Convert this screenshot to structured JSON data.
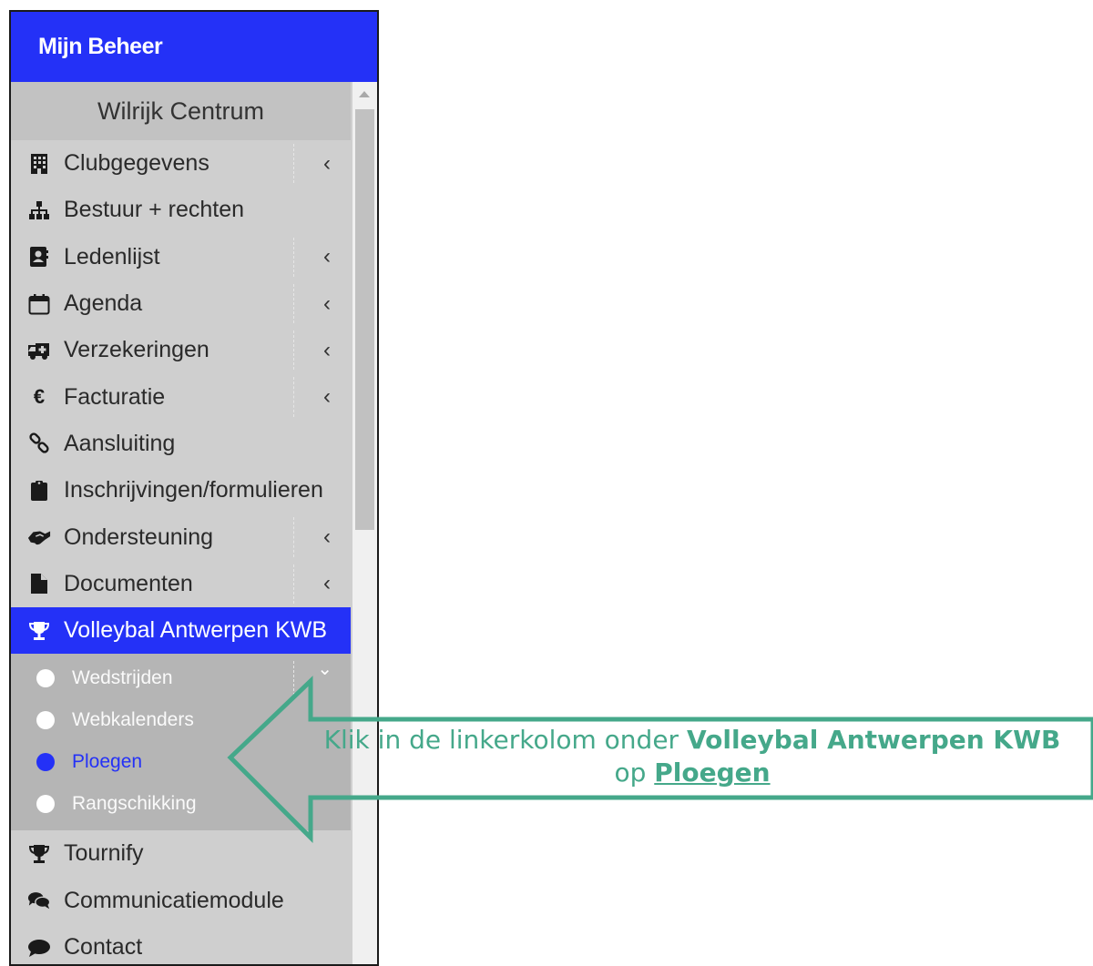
{
  "header": {
    "title": "Mijn Beheer"
  },
  "club_name": "Wilrijk Centrum",
  "menu": [
    {
      "label": "Clubgegevens",
      "icon": "building-icon",
      "expandable": true
    },
    {
      "label": "Bestuur + rechten",
      "icon": "sitemap-icon",
      "expandable": false
    },
    {
      "label": "Ledenlijst",
      "icon": "address-book-icon",
      "expandable": true
    },
    {
      "label": "Agenda",
      "icon": "calendar-icon",
      "expandable": true
    },
    {
      "label": "Verzekeringen",
      "icon": "ambulance-icon",
      "expandable": true
    },
    {
      "label": "Facturatie",
      "icon": "euro-icon",
      "expandable": true
    },
    {
      "label": "Aansluiting",
      "icon": "link-icon",
      "expandable": false
    },
    {
      "label": "Inschrijvingen/formulieren",
      "icon": "clipboard-icon",
      "expandable": false
    },
    {
      "label": "Ondersteuning",
      "icon": "handshake-icon",
      "expandable": true
    },
    {
      "label": "Documenten",
      "icon": "file-icon",
      "expandable": true
    },
    {
      "label": "Volleybal Antwerpen KWB",
      "icon": "trophy-icon",
      "expandable": false,
      "active": true
    }
  ],
  "submenu": [
    {
      "label": "Wedstrijden",
      "selected": false
    },
    {
      "label": "Webkalenders",
      "selected": false
    },
    {
      "label": "Ploegen",
      "selected": true
    },
    {
      "label": "Rangschikking",
      "selected": false
    }
  ],
  "menu_after": [
    {
      "label": "Tournify",
      "icon": "trophy-icon"
    },
    {
      "label": "Communicatiemodule",
      "icon": "comments-icon"
    },
    {
      "label": "Contact",
      "icon": "comment-icon"
    }
  ],
  "callout": {
    "line1_prefix": "Klik in de linkerkolom onder ",
    "line1_bold": "Volleybal Antwerpen KWB",
    "line2_prefix": "op ",
    "line2_bold": "Ploegen"
  },
  "colors": {
    "header": "#2431f7",
    "accent": "#2431f7",
    "callout": "#45a88a",
    "sidebar": "#cfcfcf"
  }
}
